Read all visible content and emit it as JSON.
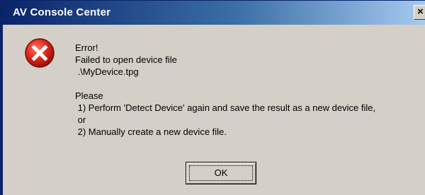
{
  "window": {
    "title": "AV Console Center",
    "close_label": "×"
  },
  "dialog": {
    "icon": "error-icon",
    "message_lines": [
      "Error!",
      "Failed to open device file",
      " .\\MyDevice.tpg",
      "",
      "Please",
      " 1) Perform 'Detect Device' again and save the result as a new device file,",
      " or",
      " 2) Manually create a new device file."
    ],
    "ok_label": "OK"
  },
  "colors": {
    "titlebar_start": "#0a246a",
    "titlebar_end": "#a6caf0",
    "dialog_bg": "#d4d0c8",
    "error_red": "#d22020"
  }
}
